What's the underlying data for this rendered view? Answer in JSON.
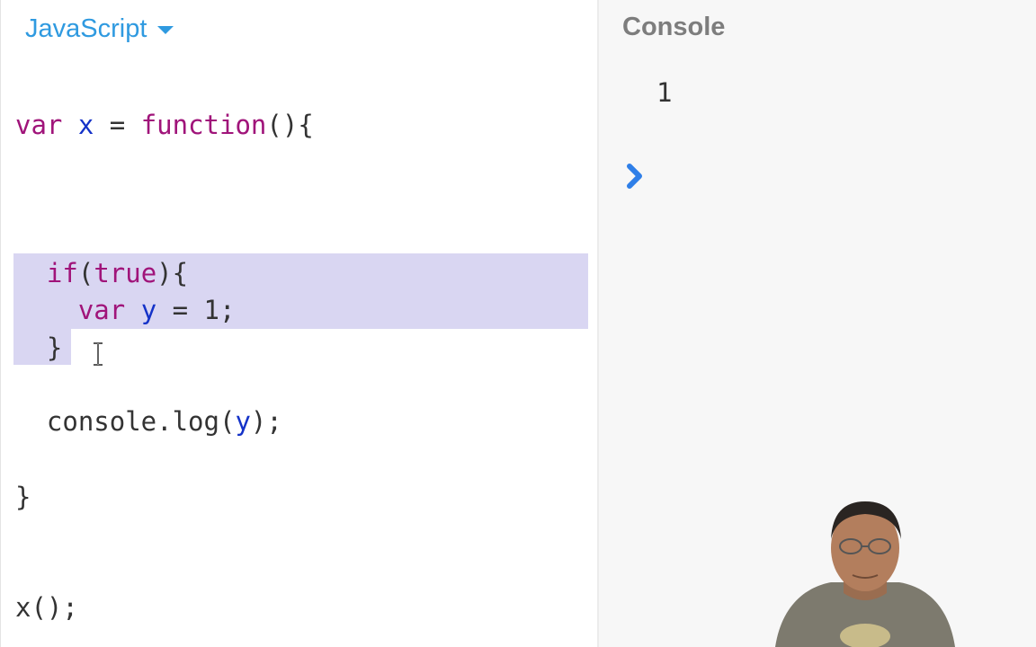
{
  "editor": {
    "language": "JavaScript",
    "lines": [
      {
        "parts": [
          {
            "t": "var",
            "c": "kw"
          },
          {
            "t": " "
          },
          {
            "t": "x",
            "c": "vr"
          },
          {
            "t": " = "
          },
          {
            "t": "function",
            "c": "kw"
          },
          {
            "t": "(){"
          }
        ]
      },
      {
        "parts": [
          {
            "t": "  "
          },
          {
            "t": "if",
            "c": "kw"
          },
          {
            "t": "("
          },
          {
            "t": "true",
            "c": "kw"
          },
          {
            "t": "){"
          }
        ]
      },
      {
        "parts": [
          {
            "t": "    "
          },
          {
            "t": "var",
            "c": "kw"
          },
          {
            "t": " "
          },
          {
            "t": "y",
            "c": "vr"
          },
          {
            "t": " = 1;"
          }
        ]
      },
      {
        "parts": [
          {
            "t": "  }"
          }
        ]
      },
      {
        "parts": [
          {
            "t": "  console.log("
          },
          {
            "t": "y",
            "c": "vr"
          },
          {
            "t": ");"
          }
        ]
      },
      {
        "parts": [
          {
            "t": "}"
          }
        ]
      },
      {
        "parts": [
          {
            "t": "x();"
          }
        ]
      }
    ]
  },
  "console": {
    "title": "Console",
    "output": [
      "1"
    ],
    "prompt_icon": "chevron-right-icon"
  },
  "colors": {
    "accent": "#2f9ae0",
    "keyword": "#a0147a",
    "variable": "#1432c8",
    "selection": "#d9d6f2",
    "console_bg": "#f7f7f7"
  }
}
